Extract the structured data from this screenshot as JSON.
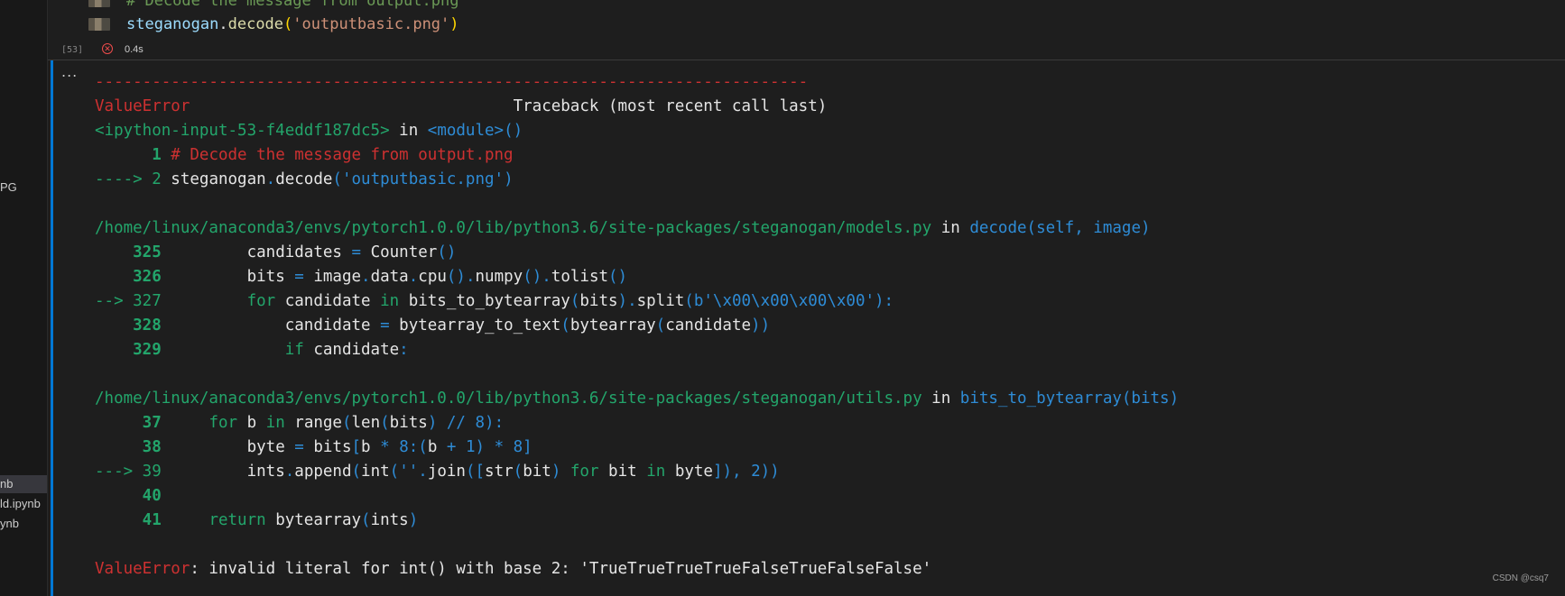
{
  "explorer": {
    "fragments": [
      {
        "text": "PG"
      },
      {
        "text": "nb"
      },
      {
        "text": "ld.ipynb"
      },
      {
        "text": "ynb"
      }
    ]
  },
  "cell": {
    "exec_count": "[53]",
    "duration": "0.4s",
    "line1_comment": "# Decode the message from output.png",
    "line2_obj": "steganogan",
    "line2_method": "decode",
    "line2_arg": "'outputbasic.png'"
  },
  "output": {
    "ellipsis": "...",
    "separator": "---------------------------------------------------------------------------",
    "err_name": "ValueError",
    "traceback_title": "Traceback (most recent call last)",
    "frame0_file": "<ipython-input-53-f4eddf187dc5>",
    "frame0_in": " in ",
    "frame0_module": "<module>()",
    "frame0_l1_num": "      1 ",
    "frame0_l1_code": "# Decode the message from output.png",
    "frame0_l2_arrow": "----> 2 ",
    "frame0_l2_obj": "steganogan",
    "frame0_l2_dot": ".",
    "frame0_l2_fn": "decode",
    "frame0_l2_args": "('outputbasic.png')",
    "frame1_file": "/home/linux/anaconda3/envs/pytorch1.0.0/lib/python3.6/site-packages/steganogan/models.py",
    "frame1_in": " in ",
    "frame1_fn": "decode(self, image)",
    "frame2_file": "/home/linux/anaconda3/envs/pytorch1.0.0/lib/python3.6/site-packages/steganogan/utils.py",
    "frame2_in": " in ",
    "frame2_fn": "bits_to_bytearray(bits)",
    "final_name": "ValueError",
    "final_msg": ": invalid literal for int() with base 2: 'TrueTrueTrueTrueFalseTrueFalseFalse'"
  },
  "watermark": "CSDN @csq7",
  "colors": {
    "error_red": "#cd3131",
    "green": "#23a56b",
    "blue": "#2e8cd6",
    "focus_border": "#0078d4"
  }
}
